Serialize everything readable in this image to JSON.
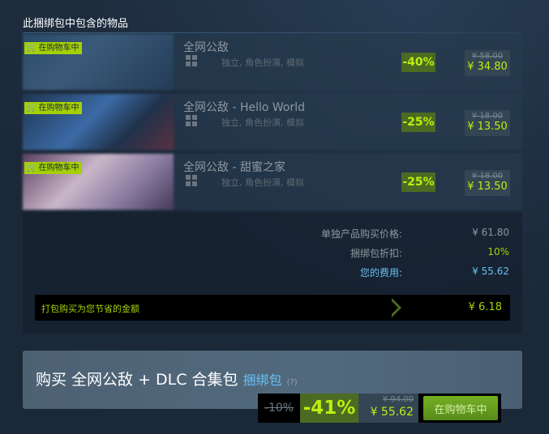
{
  "section_title": "此捆绑包中包含的物品",
  "in_cart_label": "在购物车中",
  "items": [
    {
      "name": "全网公敌",
      "genres": "独立, 角色扮演, 模拟",
      "discount": "-40%",
      "original_price": "¥ 58.00",
      "final_price": "¥ 34.80"
    },
    {
      "name": "全网公敌 - Hello World",
      "genres": "独立, 角色扮演, 模拟",
      "discount": "-25%",
      "original_price": "¥ 18.00",
      "final_price": "¥ 13.50"
    },
    {
      "name": "全网公敌 - 甜蜜之家",
      "genres": "独立, 角色扮演, 模拟",
      "discount": "-25%",
      "original_price": "¥ 18.00",
      "final_price": "¥ 13.50"
    }
  ],
  "summary": {
    "individual_label": "单独产品购买价格:",
    "individual_value": "¥ 61.80",
    "bundle_discount_label": "捆绑包折扣:",
    "bundle_discount_value": "10%",
    "your_cost_label": "您的费用:",
    "your_cost_value": "¥ 55.62",
    "savings_label": "打包购买为您节省的金额",
    "savings_value": "¥ 6.18"
  },
  "purchase": {
    "title": "购买 全网公敌 + DLC 合集包",
    "bundle_link": "捆绑包",
    "help": "(?)",
    "bundle_discount": "-10%",
    "discount": "-41%",
    "original_price": "¥ 94.00",
    "final_price": "¥ 55.62",
    "cart_button": "在购物车中"
  },
  "colors": {
    "background": "#1b2838",
    "accent_green": "#a4d007",
    "discount_green": "#beee11",
    "link_blue": "#66c0f4"
  }
}
